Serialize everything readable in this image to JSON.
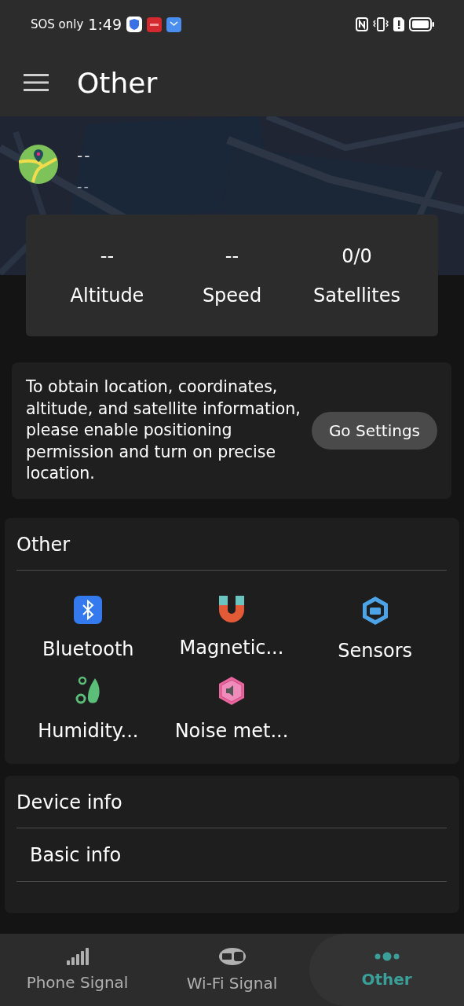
{
  "status_bar": {
    "carrier": "SOS only",
    "time": "1:49"
  },
  "app_bar": {
    "title": "Other"
  },
  "location": {
    "line_1": "--",
    "line_2": "--"
  },
  "stats": [
    {
      "value": "--",
      "label": "Altitude"
    },
    {
      "value": "--",
      "label": "Speed"
    },
    {
      "value": "0/0",
      "label": "Satellites"
    }
  ],
  "permission": {
    "message": "To obtain location, coordinates, altitude, and satellite information, please enable positioning permission and turn on precise location.",
    "button": "Go Settings"
  },
  "other_section": {
    "title": "Other",
    "tools": [
      {
        "kind": "bluetooth",
        "label": "Bluetooth"
      },
      {
        "kind": "magnet",
        "label": "Magnetic..."
      },
      {
        "kind": "sensors",
        "label": "Sensors"
      },
      {
        "kind": "humidity",
        "label": "Humidity..."
      },
      {
        "kind": "noise",
        "label": "Noise met..."
      }
    ]
  },
  "device_section": {
    "title": "Device info",
    "items": [
      "Basic info"
    ]
  },
  "bottom_nav": [
    {
      "kind": "signal",
      "label": "Phone Signal",
      "selected": false
    },
    {
      "kind": "wifi",
      "label": "Wi-Fi Signal",
      "selected": false
    },
    {
      "kind": "dots",
      "label": "Other",
      "selected": true
    }
  ]
}
